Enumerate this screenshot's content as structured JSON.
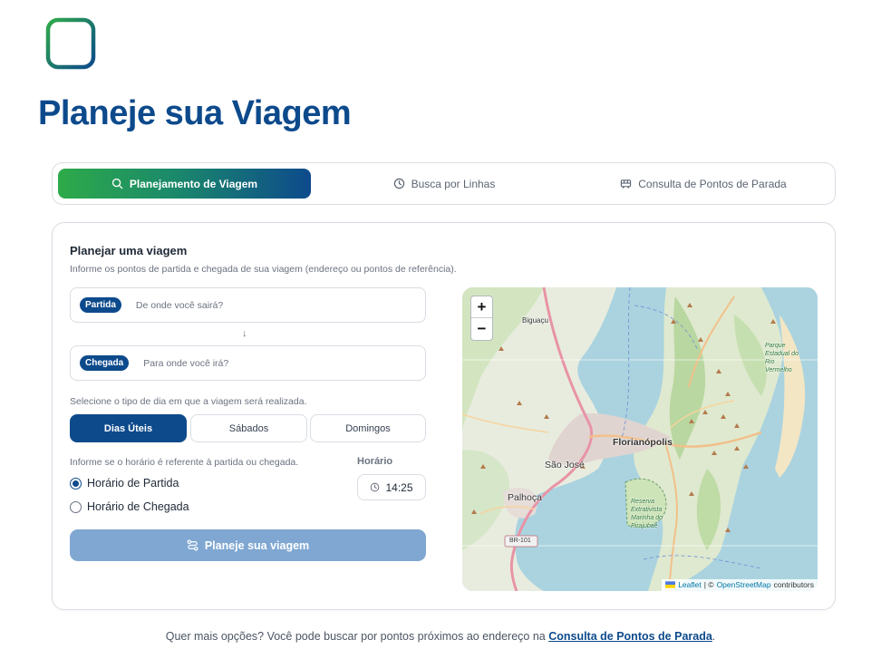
{
  "header": {
    "title": "Planeje sua Viagem",
    "logo_icon": "bus-icon",
    "colors": {
      "primary": "#0d4a8c",
      "green": "#2eaa49"
    }
  },
  "tabs": [
    {
      "label": "Planejamento de Viagem",
      "icon": "search-icon",
      "active": true
    },
    {
      "label": "Busca por Linhas",
      "icon": "clock-icon",
      "active": false
    },
    {
      "label": "Consulta de Pontos de Parada",
      "icon": "bus-small-icon",
      "active": false
    }
  ],
  "form": {
    "title": "Planejar uma viagem",
    "subtitle": "Informe os pontos de partida e chegada de sua viagem (endereço ou pontos de referência).",
    "origin": {
      "badge": "Partida",
      "placeholder": "De onde você sairá?",
      "value": ""
    },
    "destination": {
      "badge": "Chegada",
      "placeholder": "Para onde você irá?",
      "value": ""
    },
    "swap_glyph": "↓",
    "day_type_label": "Selecione o tipo de dia em que a viagem será realizada.",
    "day_types": [
      {
        "label": "Dias Úteis",
        "active": true
      },
      {
        "label": "Sábados",
        "active": false
      },
      {
        "label": "Domingos",
        "active": false
      }
    ],
    "time_ref_label": "Informe se o horário é referente à partida ou chegada.",
    "time_options": [
      {
        "label": "Horário de Partida",
        "checked": true
      },
      {
        "label": "Horário de Chegada",
        "checked": false
      }
    ],
    "time_label": "Horário",
    "time_value": "14:25",
    "submit_label": "Planeje sua viagem"
  },
  "map": {
    "zoom_in": "+",
    "zoom_out": "−",
    "labels": {
      "biguacu": "Biguaçu",
      "florianopolis": "Florianópolis",
      "sao_jose": "São José",
      "palhoca": "Palhoça",
      "br101": "BR-101",
      "parque": "Parque Estadual do Rio Vermelho",
      "reserva": "Reserva Extrativista Marinha do Pirajubaé"
    },
    "attribution": {
      "leaflet": "Leaflet",
      "sep": "| ©",
      "osm": "OpenStreetMap",
      "contributors": "contributors"
    }
  },
  "footer": {
    "text": "Quer mais opções? Você pode buscar por pontos próximos ao endereço na ",
    "link": "Consulta de Pontos de Parada",
    "end": "."
  }
}
